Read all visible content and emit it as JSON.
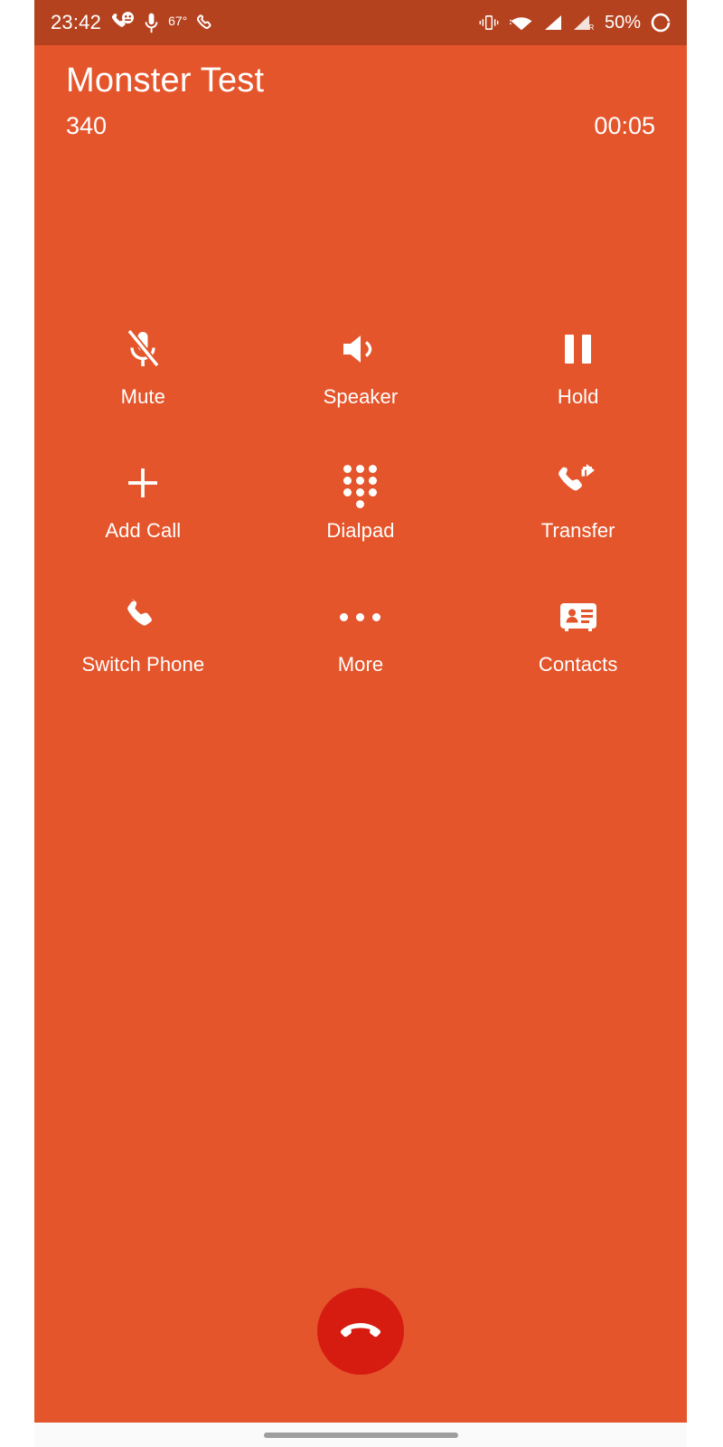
{
  "theme": {
    "status_bar_bg": "#b5421f",
    "call_bg": "#e4552b",
    "end_call_bg": "#d61c11",
    "text_color": "#ffffff",
    "nav_bar_bg": "#fafafa",
    "nav_pill_color": "#9e9e9e"
  },
  "status_bar": {
    "clock": "23:42",
    "temperature": "67°",
    "battery_percent": "50%",
    "left_icons": [
      "missed-call-icon",
      "microphone-icon",
      "phone-call-icon"
    ],
    "right_icons": [
      "vibrate-icon",
      "wifi-icon",
      "signal-bars-icon",
      "signal-bars-roaming-icon",
      "battery-circle-icon"
    ]
  },
  "call": {
    "caller_name": "Monster Test",
    "caller_number": "340",
    "duration": "00:05"
  },
  "buttons": [
    {
      "label": "Mute",
      "icon": "microphone-muted-icon",
      "name": "mute-button"
    },
    {
      "label": "Speaker",
      "icon": "speaker-volume-icon",
      "name": "speaker-button"
    },
    {
      "label": "Hold",
      "icon": "pause-icon",
      "name": "hold-button"
    },
    {
      "label": "Add Call",
      "icon": "plus-icon",
      "name": "add-call-button"
    },
    {
      "label": "Dialpad",
      "icon": "dialpad-icon",
      "name": "dialpad-button"
    },
    {
      "label": "Transfer",
      "icon": "call-transfer-icon",
      "name": "transfer-button"
    },
    {
      "label": "Switch Phone",
      "icon": "phone-handset-icon",
      "name": "switch-phone-button"
    },
    {
      "label": "More",
      "icon": "more-horizontal-icon",
      "name": "more-button"
    },
    {
      "label": "Contacts",
      "icon": "contact-card-icon",
      "name": "contacts-button"
    }
  ],
  "end_call": {
    "icon": "end-call-icon",
    "label": "End Call"
  },
  "nav_bar": {
    "gesture_pill": "home-gesture-pill"
  }
}
